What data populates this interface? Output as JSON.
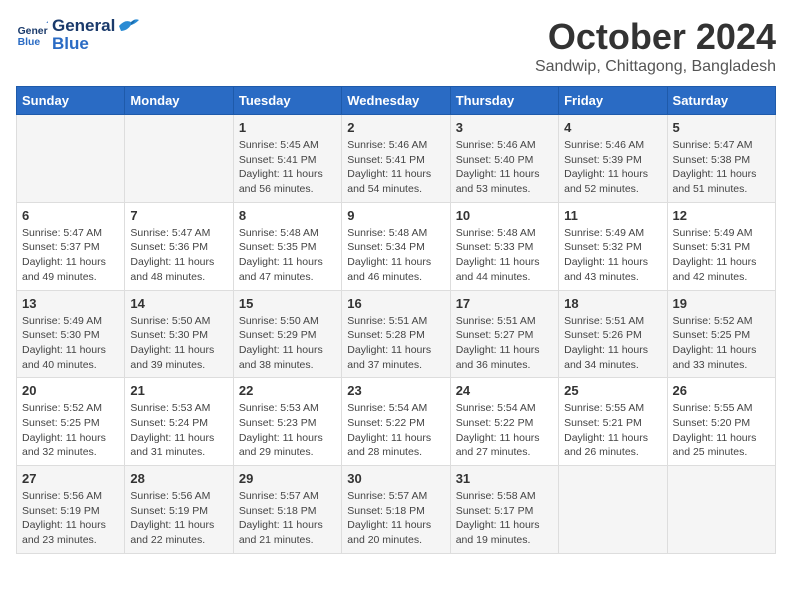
{
  "logo": {
    "line1": "General",
    "line2": "Blue"
  },
  "title": "October 2024",
  "subtitle": "Sandwip, Chittagong, Bangladesh",
  "weekdays": [
    "Sunday",
    "Monday",
    "Tuesday",
    "Wednesday",
    "Thursday",
    "Friday",
    "Saturday"
  ],
  "weeks": [
    [
      {
        "day": "",
        "sunrise": "",
        "sunset": "",
        "daylight": ""
      },
      {
        "day": "",
        "sunrise": "",
        "sunset": "",
        "daylight": ""
      },
      {
        "day": "1",
        "sunrise": "Sunrise: 5:45 AM",
        "sunset": "Sunset: 5:41 PM",
        "daylight": "Daylight: 11 hours and 56 minutes."
      },
      {
        "day": "2",
        "sunrise": "Sunrise: 5:46 AM",
        "sunset": "Sunset: 5:41 PM",
        "daylight": "Daylight: 11 hours and 54 minutes."
      },
      {
        "day": "3",
        "sunrise": "Sunrise: 5:46 AM",
        "sunset": "Sunset: 5:40 PM",
        "daylight": "Daylight: 11 hours and 53 minutes."
      },
      {
        "day": "4",
        "sunrise": "Sunrise: 5:46 AM",
        "sunset": "Sunset: 5:39 PM",
        "daylight": "Daylight: 11 hours and 52 minutes."
      },
      {
        "day": "5",
        "sunrise": "Sunrise: 5:47 AM",
        "sunset": "Sunset: 5:38 PM",
        "daylight": "Daylight: 11 hours and 51 minutes."
      }
    ],
    [
      {
        "day": "6",
        "sunrise": "Sunrise: 5:47 AM",
        "sunset": "Sunset: 5:37 PM",
        "daylight": "Daylight: 11 hours and 49 minutes."
      },
      {
        "day": "7",
        "sunrise": "Sunrise: 5:47 AM",
        "sunset": "Sunset: 5:36 PM",
        "daylight": "Daylight: 11 hours and 48 minutes."
      },
      {
        "day": "8",
        "sunrise": "Sunrise: 5:48 AM",
        "sunset": "Sunset: 5:35 PM",
        "daylight": "Daylight: 11 hours and 47 minutes."
      },
      {
        "day": "9",
        "sunrise": "Sunrise: 5:48 AM",
        "sunset": "Sunset: 5:34 PM",
        "daylight": "Daylight: 11 hours and 46 minutes."
      },
      {
        "day": "10",
        "sunrise": "Sunrise: 5:48 AM",
        "sunset": "Sunset: 5:33 PM",
        "daylight": "Daylight: 11 hours and 44 minutes."
      },
      {
        "day": "11",
        "sunrise": "Sunrise: 5:49 AM",
        "sunset": "Sunset: 5:32 PM",
        "daylight": "Daylight: 11 hours and 43 minutes."
      },
      {
        "day": "12",
        "sunrise": "Sunrise: 5:49 AM",
        "sunset": "Sunset: 5:31 PM",
        "daylight": "Daylight: 11 hours and 42 minutes."
      }
    ],
    [
      {
        "day": "13",
        "sunrise": "Sunrise: 5:49 AM",
        "sunset": "Sunset: 5:30 PM",
        "daylight": "Daylight: 11 hours and 40 minutes."
      },
      {
        "day": "14",
        "sunrise": "Sunrise: 5:50 AM",
        "sunset": "Sunset: 5:30 PM",
        "daylight": "Daylight: 11 hours and 39 minutes."
      },
      {
        "day": "15",
        "sunrise": "Sunrise: 5:50 AM",
        "sunset": "Sunset: 5:29 PM",
        "daylight": "Daylight: 11 hours and 38 minutes."
      },
      {
        "day": "16",
        "sunrise": "Sunrise: 5:51 AM",
        "sunset": "Sunset: 5:28 PM",
        "daylight": "Daylight: 11 hours and 37 minutes."
      },
      {
        "day": "17",
        "sunrise": "Sunrise: 5:51 AM",
        "sunset": "Sunset: 5:27 PM",
        "daylight": "Daylight: 11 hours and 36 minutes."
      },
      {
        "day": "18",
        "sunrise": "Sunrise: 5:51 AM",
        "sunset": "Sunset: 5:26 PM",
        "daylight": "Daylight: 11 hours and 34 minutes."
      },
      {
        "day": "19",
        "sunrise": "Sunrise: 5:52 AM",
        "sunset": "Sunset: 5:25 PM",
        "daylight": "Daylight: 11 hours and 33 minutes."
      }
    ],
    [
      {
        "day": "20",
        "sunrise": "Sunrise: 5:52 AM",
        "sunset": "Sunset: 5:25 PM",
        "daylight": "Daylight: 11 hours and 32 minutes."
      },
      {
        "day": "21",
        "sunrise": "Sunrise: 5:53 AM",
        "sunset": "Sunset: 5:24 PM",
        "daylight": "Daylight: 11 hours and 31 minutes."
      },
      {
        "day": "22",
        "sunrise": "Sunrise: 5:53 AM",
        "sunset": "Sunset: 5:23 PM",
        "daylight": "Daylight: 11 hours and 29 minutes."
      },
      {
        "day": "23",
        "sunrise": "Sunrise: 5:54 AM",
        "sunset": "Sunset: 5:22 PM",
        "daylight": "Daylight: 11 hours and 28 minutes."
      },
      {
        "day": "24",
        "sunrise": "Sunrise: 5:54 AM",
        "sunset": "Sunset: 5:22 PM",
        "daylight": "Daylight: 11 hours and 27 minutes."
      },
      {
        "day": "25",
        "sunrise": "Sunrise: 5:55 AM",
        "sunset": "Sunset: 5:21 PM",
        "daylight": "Daylight: 11 hours and 26 minutes."
      },
      {
        "day": "26",
        "sunrise": "Sunrise: 5:55 AM",
        "sunset": "Sunset: 5:20 PM",
        "daylight": "Daylight: 11 hours and 25 minutes."
      }
    ],
    [
      {
        "day": "27",
        "sunrise": "Sunrise: 5:56 AM",
        "sunset": "Sunset: 5:19 PM",
        "daylight": "Daylight: 11 hours and 23 minutes."
      },
      {
        "day": "28",
        "sunrise": "Sunrise: 5:56 AM",
        "sunset": "Sunset: 5:19 PM",
        "daylight": "Daylight: 11 hours and 22 minutes."
      },
      {
        "day": "29",
        "sunrise": "Sunrise: 5:57 AM",
        "sunset": "Sunset: 5:18 PM",
        "daylight": "Daylight: 11 hours and 21 minutes."
      },
      {
        "day": "30",
        "sunrise": "Sunrise: 5:57 AM",
        "sunset": "Sunset: 5:18 PM",
        "daylight": "Daylight: 11 hours and 20 minutes."
      },
      {
        "day": "31",
        "sunrise": "Sunrise: 5:58 AM",
        "sunset": "Sunset: 5:17 PM",
        "daylight": "Daylight: 11 hours and 19 minutes."
      },
      {
        "day": "",
        "sunrise": "",
        "sunset": "",
        "daylight": ""
      },
      {
        "day": "",
        "sunrise": "",
        "sunset": "",
        "daylight": ""
      }
    ]
  ]
}
